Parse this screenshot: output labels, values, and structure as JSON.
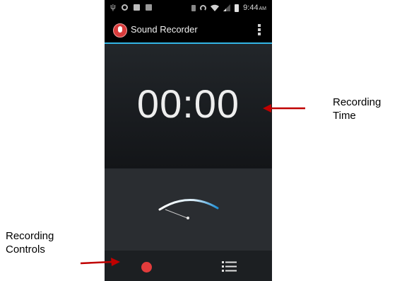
{
  "status_bar": {
    "time": "9:44",
    "ampm": "AM",
    "left_icons": [
      "usb-icon",
      "circle-icon",
      "square-icon",
      "image-icon"
    ],
    "right_icons": [
      "vibrate-icon",
      "headset-icon",
      "wifi-icon",
      "signal-icon",
      "battery-icon"
    ]
  },
  "action_bar": {
    "title": "Sound Recorder",
    "app_icon": "microphone-icon",
    "menu_icon": "overflow-menu-icon"
  },
  "timer": {
    "value": "00:00"
  },
  "controls": {
    "record_icon": "record-icon",
    "list_icon": "list-icon"
  },
  "annotations": {
    "recording_time": [
      "Recording",
      "Time"
    ],
    "recording_controls": [
      "Recording",
      "Controls"
    ]
  },
  "colors": {
    "accent": "#33b5e5",
    "record": "#e23c3c",
    "arrow": "#c00000"
  }
}
